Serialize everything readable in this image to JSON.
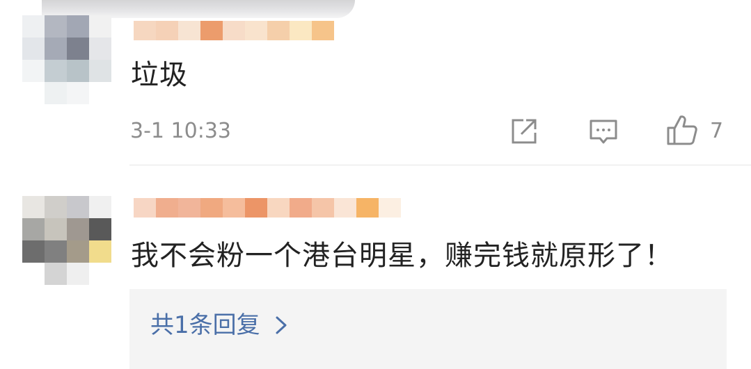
{
  "comments": [
    {
      "text": "垃圾",
      "time": "3-1 10:33",
      "likes": "7"
    },
    {
      "text": "我不会粉一个港台明星，赚完钱就原形了！",
      "reply_summary": "共1条回复"
    }
  ],
  "icons": {
    "share": "share-icon",
    "comment": "comment-icon",
    "like": "thumbs-up-icon",
    "chevron": "chevron-right-icon"
  },
  "colors": {
    "text": "#222222",
    "meta": "#8c8c8c",
    "link": "#4a6fa8",
    "reply_bg": "#f4f4f4"
  }
}
